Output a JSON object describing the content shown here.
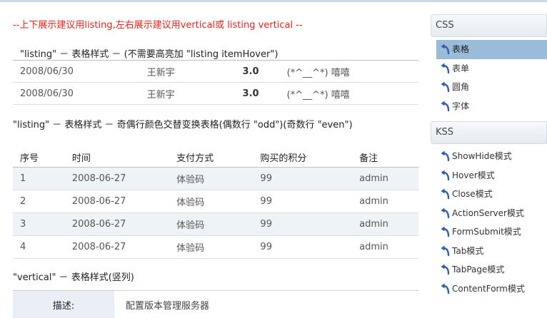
{
  "note": "--上下展示建议用listing,左右展示建议用vertical或 listing vertical --",
  "sections": {
    "listing_plain": "\"listing\" － 表格样式 － (不需要高亮加 \"listing itemHover\")",
    "listing_striped": "\"listing\" － 表格样式 － 奇偶行颜色交替变换表格(偶数行 \"odd\")(奇数行 \"even\")",
    "vertical": "\"vertical\" － 表格样式(竖列)"
  },
  "table_plain": {
    "rows": [
      [
        "2008/06/30",
        "王新宇",
        "3.0",
        "(*^__^*) 嘻嘻"
      ],
      [
        "2008/06/30",
        "王新宇",
        "3.0",
        "(*^__^*) 嘻嘻"
      ]
    ]
  },
  "table_striped": {
    "headers": [
      "序号",
      "时间",
      "支付方式",
      "购买的积分",
      "备注"
    ],
    "rows": [
      [
        "1",
        "2008-06-27",
        "体验码",
        "99",
        "admin"
      ],
      [
        "2",
        "2008-06-27",
        "体验码",
        "99",
        "admin"
      ],
      [
        "3",
        "2008-06-27",
        "体验码",
        "99",
        "admin"
      ],
      [
        "4",
        "2008-06-27",
        "体验码",
        "99",
        "admin"
      ]
    ]
  },
  "table_vertical": {
    "label": "描述:",
    "value": "配置版本管理服务器"
  },
  "sidebar": {
    "css": {
      "title": "CSS",
      "items": [
        "表格",
        "表单",
        "圆角",
        "字体"
      ],
      "active_index": 0
    },
    "kss": {
      "title": "KSS",
      "items": [
        "ShowHide模式",
        "Hover模式",
        "Close模式",
        "ActionServer模式",
        "FormSubmit模式",
        "Tab模式",
        "TabPage模式",
        "ContentForm模式"
      ]
    }
  },
  "colors": {
    "note_red": "#e4241b",
    "active_item": "#9bbcd9",
    "odd_row": "#eef3f7",
    "icon_blue": "#2f5fa6"
  },
  "icon": "curved-arrow-icon"
}
